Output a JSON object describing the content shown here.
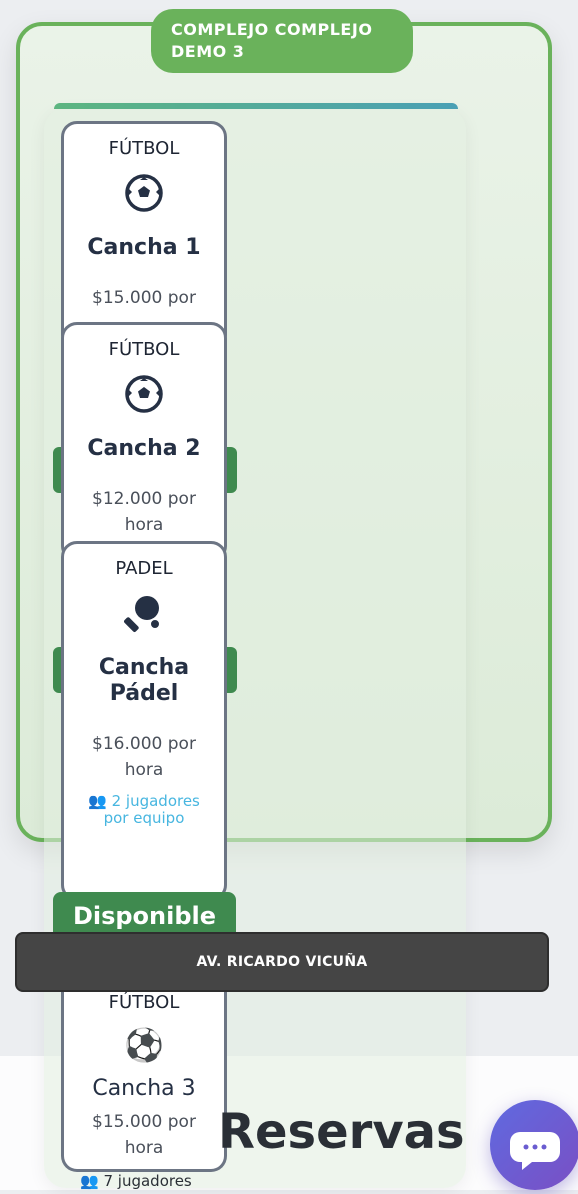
{
  "complex": {
    "name": "COMPLEJO COMPLEJO DEMO 3"
  },
  "courts": [
    {
      "sport": "FÚTBOL",
      "name": "Cancha 1",
      "price": "$15.000 por",
      "icon": "soccer-ball-icon"
    },
    {
      "sport": "FÚTBOL",
      "name": "Cancha 2",
      "price": "$12.000 por hora",
      "icon": "soccer-ball-icon"
    },
    {
      "sport": "PADEL",
      "name": "Cancha Pádel",
      "price": "$16.000 por hora",
      "players": "2 jugadores por equipo",
      "icon": "paddle-icon"
    },
    {
      "sport": "FÚTBOL",
      "name": "Cancha 3",
      "price": "$15.000 por hora",
      "players": "7 jugadores",
      "icon": "soccer-ball-emoji-icon"
    }
  ],
  "status": {
    "label": "Disponible",
    "color": "#3f8a4f"
  },
  "address": "AV. RICARDO VICUÑA",
  "section": {
    "title": "Reservas"
  },
  "chat": {
    "icon": "chat-bubble-icon"
  },
  "colors": {
    "accent": "#6ab25b",
    "card_border": "#6c7584",
    "players_text": "#47b6e0"
  }
}
